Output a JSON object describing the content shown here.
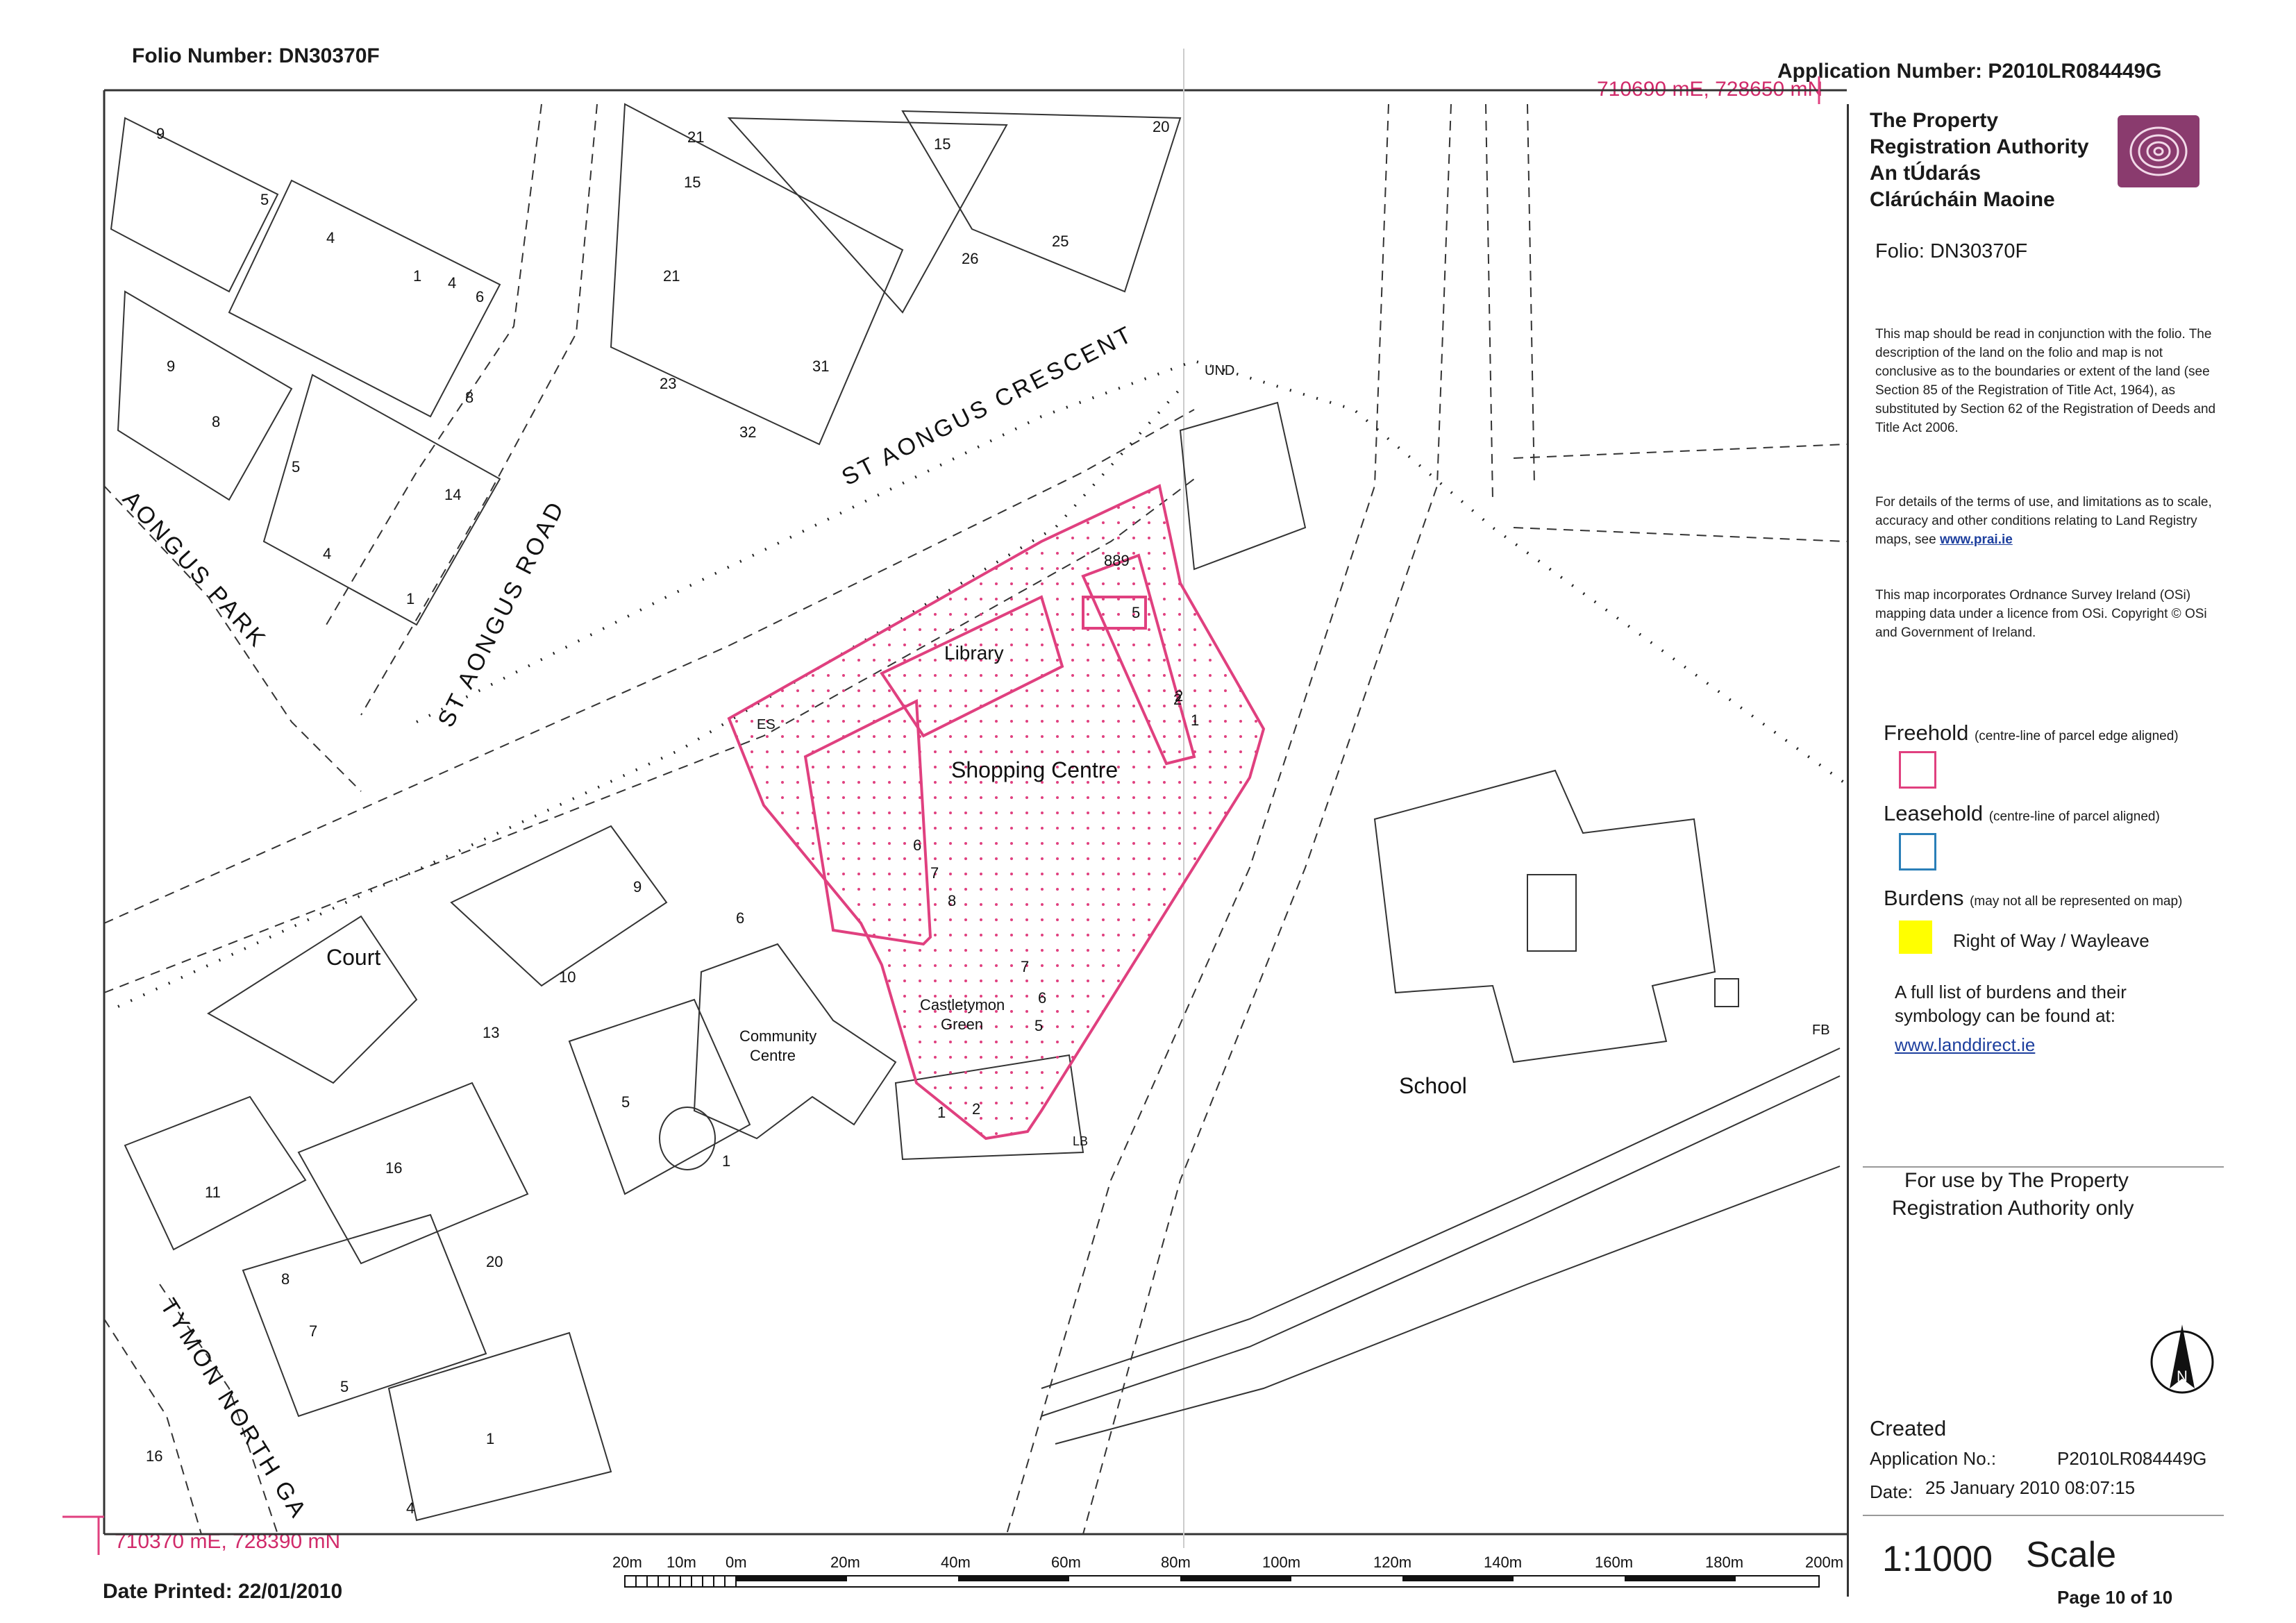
{
  "header": {
    "folio_number": "Folio Number: DN30370F",
    "application_number": "Application Number: P2010LR084449G",
    "top_coordinate": "710690 mE, 728650 mN",
    "bottom_coordinate": "710370 mE, 728390 mN",
    "date_printed": "Date Printed: 22/01/2010"
  },
  "panel": {
    "authority_en_1": "The Property",
    "authority_en_2": "Registration Authority",
    "authority_ga_1": "An tÚdarás",
    "authority_ga_2": "Clárúcháin Maoine",
    "folio": "Folio:   DN30370F",
    "note1": "This map should be read in conjunction with the folio. The description of the land on the folio and map is not conclusive as to the boundaries or extent of the land (see Section 85 of the Registration of Title Act, 1964), as substituted by Section 62 of the Registration of Deeds and Title Act 2006.",
    "note2_text": "For details of the terms of use, and limitations as to scale, accuracy and other conditions relating to Land Registry maps, see",
    "note2_link": "www.prai.ie",
    "note3": "This map incorporates Ordnance Survey Ireland (OSi) mapping data under a licence from OSi. Copyright © OSi and Government of Ireland.",
    "freehold_label": "Freehold",
    "freehold_note": "(centre-line of parcel edge aligned)",
    "leasehold_label": "Leasehold",
    "leasehold_note": "(centre-line of parcel aligned)",
    "burdens_label": "Burdens",
    "burdens_note": "(may not all be represented on map)",
    "row_label": "Right of Way / Wayleave",
    "burden_list_text": "A full list of burdens and their symbology can be found at:",
    "burden_list_link": "www.landdirect.ie",
    "office_use_1": "For use by The Property",
    "office_use_2": "Registration Authority only",
    "north_letter": "N",
    "created": "Created",
    "app_no_label": "Application No.:",
    "app_no_value": "P2010LR084449G",
    "date_label": "Date:",
    "date_value": "25 January 2010 08:07:15",
    "scale_ratio": "1:1000",
    "scale_word": "Scale",
    "page": "Page 10 of 10"
  },
  "colors": {
    "freehold": "#e0407f",
    "leasehold": "#2a7fb8",
    "burden": "#ffff00",
    "logo": "#8a3b6e"
  },
  "map": {
    "roads": {
      "st_aongus_crescent": "ST AONGUS CRESCENT",
      "st_aongus_road": "ST AONGUS ROAD",
      "aongus_park": "AONGUS PARK",
      "tymon_north": "TYMON NORTH GA"
    },
    "labels": {
      "library": "Library",
      "shopping_centre": "Shopping Centre",
      "court": "Court",
      "community_1": "Community",
      "community_2": "Centre",
      "castletymon_1": "Castletymon",
      "castletymon_2": "Green",
      "school": "School",
      "und": "UND",
      "es": "ES",
      "fb": "FB",
      "lb": "LB",
      "n889": "889"
    },
    "numbers": [
      "9",
      "5",
      "4",
      "1",
      "4",
      "6",
      "9",
      "8",
      "8",
      "5",
      "14",
      "4",
      "1",
      "21",
      "15",
      "21",
      "23",
      "32",
      "15",
      "26",
      "31",
      "25",
      "20",
      "5",
      "2",
      "1",
      "6",
      "7",
      "8",
      "9",
      "6",
      "10",
      "13",
      "7",
      "6",
      "5",
      "5",
      "1",
      "16",
      "11",
      "8",
      "7",
      "5",
      "20",
      "1",
      "16",
      "4",
      "1",
      "2",
      "2"
    ]
  },
  "scalebar": {
    "ticks": [
      "20m",
      "10m",
      "0m",
      "20m",
      "40m",
      "60m",
      "80m",
      "100m",
      "120m",
      "140m",
      "160m",
      "180m",
      "200m"
    ]
  }
}
